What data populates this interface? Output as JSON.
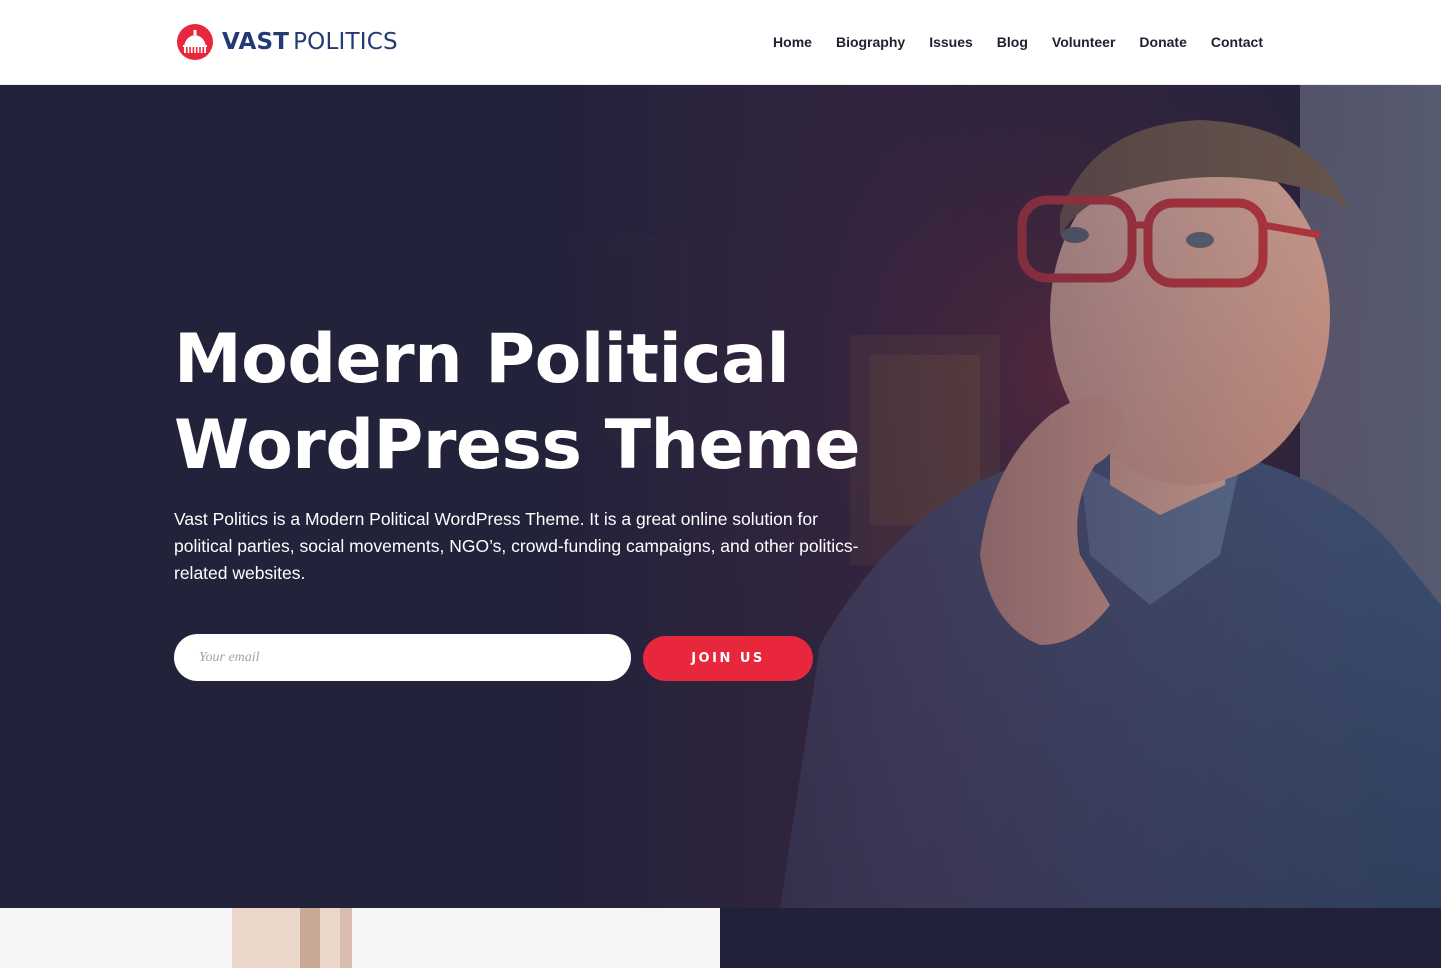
{
  "brand": {
    "name_bold": "VAST",
    "name_light": "POLITICS",
    "logo_icon": "capitol-dome-icon",
    "primary_color": "#233a73",
    "accent_color": "#e8273d"
  },
  "nav": {
    "items": [
      {
        "label": "Home"
      },
      {
        "label": "Biography"
      },
      {
        "label": "Issues"
      },
      {
        "label": "Blog"
      },
      {
        "label": "Volunteer"
      },
      {
        "label": "Donate"
      },
      {
        "label": "Contact"
      }
    ]
  },
  "hero": {
    "title_line1": "Modern Political",
    "title_line2": "WordPress Theme",
    "description": "Vast Politics is a Modern Political WordPress Theme. It is a great online solution for political parties, social movements, NGO’s, crowd-funding campaigns, and other politics-related websites.",
    "email_placeholder": "Your email",
    "email_value": "",
    "cta_label": "JOIN US",
    "overlay_color": "#22223a"
  }
}
